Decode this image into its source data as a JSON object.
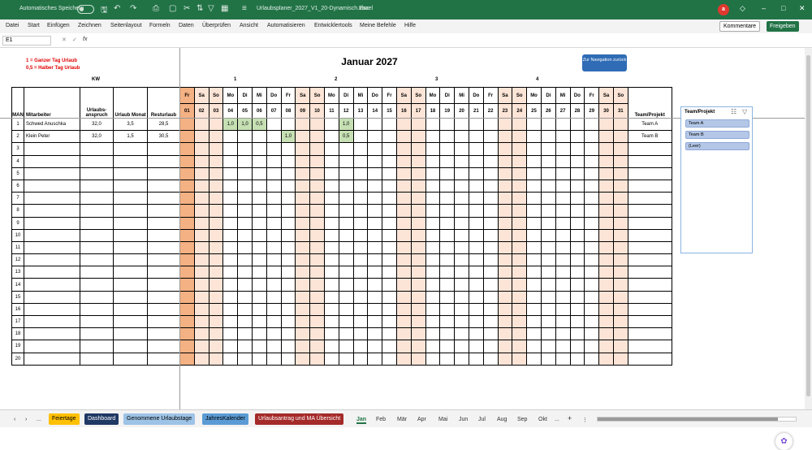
{
  "titlebar": {
    "autosave_label": "Automatisches Speichern",
    "filename": "Urlaubsplaner_2027_V1_20-Dynamisch.xlsx",
    "app": "Excel",
    "avatar_text": "a",
    "min": "–",
    "max": "□",
    "close": "✕"
  },
  "menu": {
    "items": [
      "Datei",
      "Start",
      "Einfügen",
      "Zeichnen",
      "Seitenlayout",
      "Formeln",
      "Daten",
      "Überprüfen",
      "Ansicht",
      "Automatisieren",
      "Entwicklertools",
      "Meine Befehle",
      "Hilfe"
    ],
    "comments": "Kommentare",
    "share": "Freigeben"
  },
  "formula": {
    "cell": "E1",
    "fx": "fx",
    "value": ""
  },
  "sheet": {
    "note1": "1 = Ganzer Tag Urlaub",
    "note2": "0,5 = Halber Tag Urlaub",
    "kw_label": "KW",
    "title": "Januar 2027",
    "nav_button": "Zur Navigation zurück",
    "weeks": [
      "1",
      "2",
      "3",
      "4"
    ],
    "headers": {
      "man": "MAN",
      "mitarbeiter": "Mitarbeiter",
      "anspruch": "Urlaubs-anspruch",
      "monat": "Urlaub Monat",
      "rest": "Resturlaub",
      "team": "Team/Projekt"
    },
    "weekdays": [
      "Fr",
      "Sa",
      "So",
      "Mo",
      "Di",
      "Mi",
      "Do",
      "Fr",
      "Sa",
      "So",
      "Mo",
      "Di",
      "Mi",
      "Do",
      "Fr",
      "Sa",
      "So",
      "Mo",
      "Di",
      "Mi",
      "Do",
      "Fr",
      "Sa",
      "So",
      "Mo",
      "Di",
      "Mi",
      "Do",
      "Fr",
      "Sa",
      "So"
    ],
    "days": [
      "01",
      "02",
      "03",
      "04",
      "05",
      "06",
      "07",
      "08",
      "09",
      "10",
      "11",
      "12",
      "13",
      "14",
      "15",
      "16",
      "17",
      "18",
      "19",
      "20",
      "21",
      "22",
      "23",
      "24",
      "25",
      "26",
      "27",
      "28",
      "29",
      "30",
      "31"
    ],
    "rows": [
      {
        "man": "1",
        "name": "Schwed Anuschka",
        "anspruch": "32,0",
        "monat": "3,5",
        "rest": "28,5",
        "team": "Team A",
        "days": {
          "4": "1,0",
          "5": "1,0",
          "6": "0,5",
          "12": "1,0"
        }
      },
      {
        "man": "2",
        "name": "Klein Peter",
        "anspruch": "32,0",
        "monat": "1,5",
        "rest": "30,5",
        "team": "Team B",
        "days": {
          "8": "1,0",
          "12": "0,5"
        }
      },
      {
        "man": "3"
      },
      {
        "man": "4"
      },
      {
        "man": "5"
      },
      {
        "man": "6"
      },
      {
        "man": "7"
      },
      {
        "man": "8"
      },
      {
        "man": "9"
      },
      {
        "man": "10"
      },
      {
        "man": "11"
      },
      {
        "man": "12"
      },
      {
        "man": "13"
      },
      {
        "man": "14"
      },
      {
        "man": "15"
      },
      {
        "man": "16"
      },
      {
        "man": "17"
      },
      {
        "man": "18"
      },
      {
        "man": "19"
      },
      {
        "man": "20"
      }
    ],
    "colors": {
      "weekend": "#fce4d6",
      "friday_first": "#f4b183",
      "vacation": "#c6e0b4"
    }
  },
  "slicer": {
    "title": "Team/Projekt",
    "items": [
      "Team A",
      "Team B",
      "(Leer)"
    ]
  },
  "tabs": {
    "colored": [
      {
        "label": "Feiertage",
        "bg": "#ffc000",
        "fg": "#000"
      },
      {
        "label": "Dashboard",
        "bg": "#1f3864",
        "fg": "#fff"
      },
      {
        "label": "Genommene Urlaubstage",
        "bg": "#9dc3e6",
        "fg": "#000"
      },
      {
        "label": "JahresKalender",
        "bg": "#5b9bd5",
        "fg": "#000"
      },
      {
        "label": "Urlaubsantrag und MA Übersicht",
        "bg": "#a52a2a",
        "fg": "#fff"
      }
    ],
    "months": [
      "Jan",
      "Feb",
      "Mär",
      "Apr",
      "Mai",
      "Jun",
      "Jul",
      "Aug",
      "Sep",
      "Okt"
    ],
    "more": "...",
    "add": "+"
  }
}
